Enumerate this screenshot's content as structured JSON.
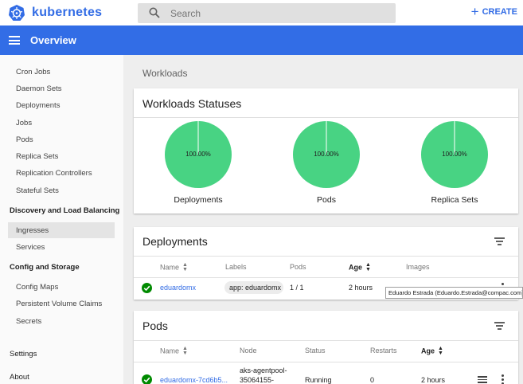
{
  "app": {
    "brand": "kubernetes",
    "create_label": "CREATE",
    "search_placeholder": "Search",
    "page_title": "Overview",
    "accent_color": "#326ce5"
  },
  "sidebar": {
    "items_a": [
      "Cron Jobs",
      "Daemon Sets",
      "Deployments",
      "Jobs",
      "Pods",
      "Replica Sets",
      "Replication Controllers",
      "Stateful Sets"
    ],
    "section_discovery": "Discovery and Load Balancing",
    "items_b": [
      "Ingresses",
      "Services"
    ],
    "section_config": "Config and Storage",
    "items_c": [
      "Config Maps",
      "Persistent Volume Claims",
      "Secrets"
    ],
    "settings": "Settings",
    "about": "About",
    "active_item": "Ingresses"
  },
  "main": {
    "section_title": "Workloads",
    "statuses": {
      "title": "Workloads Statuses",
      "charts": [
        {
          "label": "Deployments",
          "value_text": "100.00%",
          "percent": 100,
          "color": "#48d383"
        },
        {
          "label": "Pods",
          "value_text": "100.00%",
          "percent": 100,
          "color": "#48d383"
        },
        {
          "label": "Replica Sets",
          "value_text": "100.00%",
          "percent": 100,
          "color": "#48d383"
        }
      ]
    },
    "deployments": {
      "title": "Deployments",
      "headers": {
        "name": "Name",
        "labels": "Labels",
        "pods": "Pods",
        "age": "Age",
        "images": "Images"
      },
      "row": {
        "name": "eduardomx",
        "label": "app: eduardomx",
        "pods": "1 / 1",
        "age": "2 hours"
      },
      "tooltip": "Eduardo Estrada (Eduardo.Estrada@compac.com)"
    },
    "pods": {
      "title": "Pods",
      "headers": {
        "name": "Name",
        "node": "Node",
        "status": "Status",
        "restarts": "Restarts",
        "age": "Age"
      },
      "row": {
        "name": "eduardomx-7cd6b5...",
        "node_line1": "aks-agentpool-",
        "node_line2": "35064155-",
        "status": "Running",
        "restarts": "0",
        "age": "2 hours"
      }
    }
  }
}
